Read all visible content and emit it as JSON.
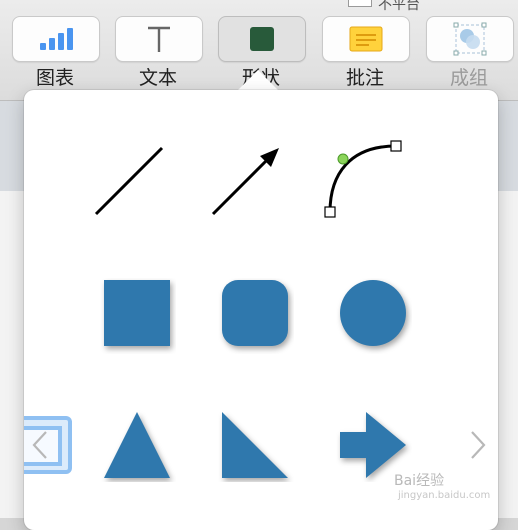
{
  "toolbar": {
    "top_text": "不平台",
    "buttons": [
      {
        "label": "图表",
        "icon": "chart-icon"
      },
      {
        "label": "文本",
        "icon": "text-icon"
      },
      {
        "label": "形状",
        "icon": "shape-icon",
        "active": true
      },
      {
        "label": "批注",
        "icon": "comment-icon"
      },
      {
        "label": "成组",
        "icon": "group-icon",
        "dim": true
      }
    ]
  },
  "shapes_popover": {
    "rows": [
      [
        "line-shape",
        "arrow-line-shape",
        "curve-shape"
      ],
      [
        "square-shape",
        "rounded-square-shape",
        "circle-shape"
      ],
      [
        "triangle-shape",
        "right-triangle-shape",
        "arrow-shape"
      ]
    ],
    "shape_color": "#2f78ad",
    "nav_prev_icon": "chevron-left-icon",
    "nav_next_icon": "chevron-right-icon"
  },
  "watermark": {
    "text": "Bai经验",
    "sub": "jingyan.baidu.com"
  }
}
